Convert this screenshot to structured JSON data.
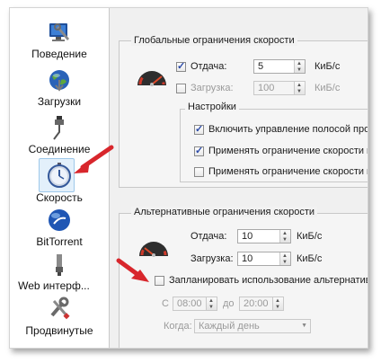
{
  "sidebar": {
    "items": [
      {
        "label": "Поведение",
        "icon": "monitor-wrench-icon"
      },
      {
        "label": "Загрузки",
        "icon": "globe-download-icon"
      },
      {
        "label": "Соединение",
        "icon": "network-plug-icon"
      },
      {
        "label": "Скорость",
        "icon": "stopwatch-icon",
        "selected": true
      },
      {
        "label": "BitTorrent",
        "icon": "bittorrent-globe-icon"
      },
      {
        "label": "Web интерф...",
        "icon": "web-ui-plug-icon"
      },
      {
        "label": "Продвинутые",
        "icon": "tools-icon"
      }
    ]
  },
  "global_limits": {
    "title": "Глобальные ограничения скорости",
    "upload": {
      "label": "Отдача:",
      "checked": true,
      "value": "5",
      "unit": "КиБ/с"
    },
    "download": {
      "label": "Загрузка:",
      "checked": false,
      "value": "100",
      "unit": "КиБ/с"
    },
    "settings": {
      "title": "Настройки",
      "options": [
        {
          "label": "Включить управление полосой пропу",
          "checked": true
        },
        {
          "label": "Применять ограничение скорости к",
          "checked": true
        },
        {
          "label": "Применять ограничение скорости к",
          "checked": false
        }
      ]
    }
  },
  "alt_limits": {
    "title": "Альтернативные ограничения скорости",
    "upload": {
      "label": "Отдача:",
      "value": "10",
      "unit": "КиБ/с"
    },
    "download": {
      "label": "Загрузка:",
      "value": "10",
      "unit": "КиБ/с"
    },
    "schedule": {
      "label": "Запланировать использование альтернатив",
      "checked": false
    },
    "from": {
      "label": "С",
      "value": "08:00"
    },
    "to": {
      "label": "до",
      "value": "20:00"
    },
    "when": {
      "label": "Когда:",
      "value": "Каждый день"
    }
  },
  "colors": {
    "arrow": "#d8262c",
    "accent": "#2b4aa8"
  }
}
